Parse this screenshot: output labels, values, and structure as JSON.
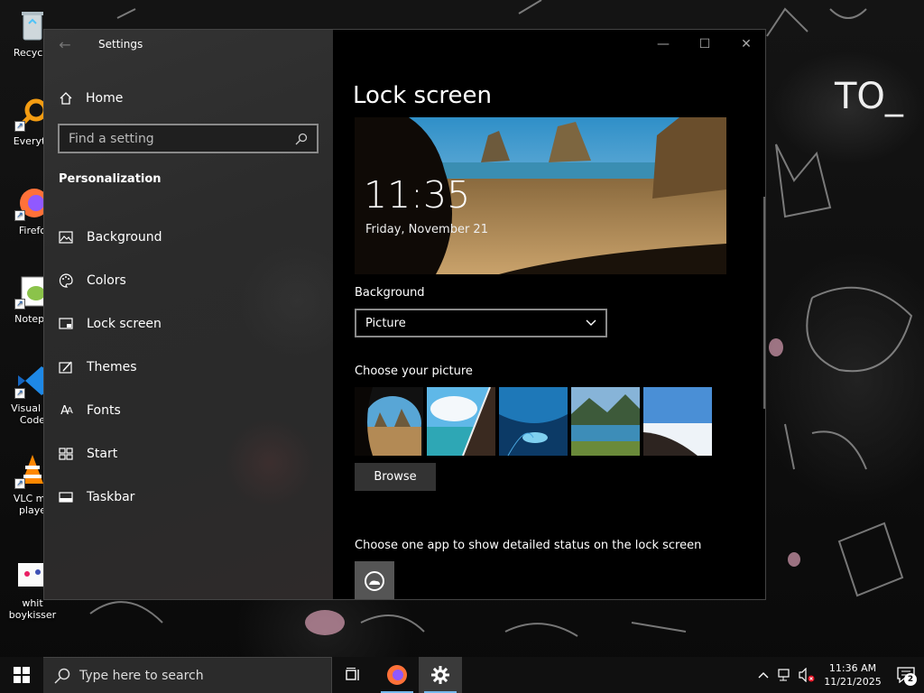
{
  "desktop": {
    "icons": [
      {
        "label": "Recycle",
        "icon": "recycle-bin-icon"
      },
      {
        "label": "Everyth",
        "icon": "everything-search-icon"
      },
      {
        "label": "Firefo",
        "icon": "firefox-icon"
      },
      {
        "label": "Notepa",
        "icon": "notepad-plus-icon"
      },
      {
        "label": "Visual St\nCode",
        "icon": "vscode-icon"
      },
      {
        "label": "VLC me\nplaye",
        "icon": "vlc-icon"
      },
      {
        "label": "whit\nboykisser",
        "icon": "image-file-icon"
      }
    ],
    "wall_text": "TO_"
  },
  "window": {
    "app_title": "Settings",
    "sidebar": {
      "home_label": "Home",
      "search_placeholder": "Find a setting",
      "section": "Personalization",
      "items": [
        {
          "label": "Background",
          "icon": "picture-icon"
        },
        {
          "label": "Colors",
          "icon": "palette-icon"
        },
        {
          "label": "Lock screen",
          "icon": "lock-screen-icon"
        },
        {
          "label": "Themes",
          "icon": "themes-icon"
        },
        {
          "label": "Fonts",
          "icon": "fonts-icon"
        },
        {
          "label": "Start",
          "icon": "start-icon"
        },
        {
          "label": "Taskbar",
          "icon": "taskbar-icon"
        }
      ]
    },
    "content": {
      "title": "Lock screen",
      "preview_time": "11:35",
      "preview_date": "Friday, November 21",
      "background_label": "Background",
      "background_value": "Picture",
      "choose_picture_label": "Choose your picture",
      "browse_label": "Browse",
      "detailed_status_label": "Choose one app to show detailed status on the lock screen"
    }
  },
  "taskbar": {
    "search_placeholder": "Type here to search",
    "time": "11:36 AM",
    "date": "11/21/2025",
    "notification_count": "2"
  },
  "colors": {
    "taskbar": "#101010",
    "sidebar": "#2b2b2b",
    "content": "#000000",
    "accent_running": "#76b9ed"
  }
}
